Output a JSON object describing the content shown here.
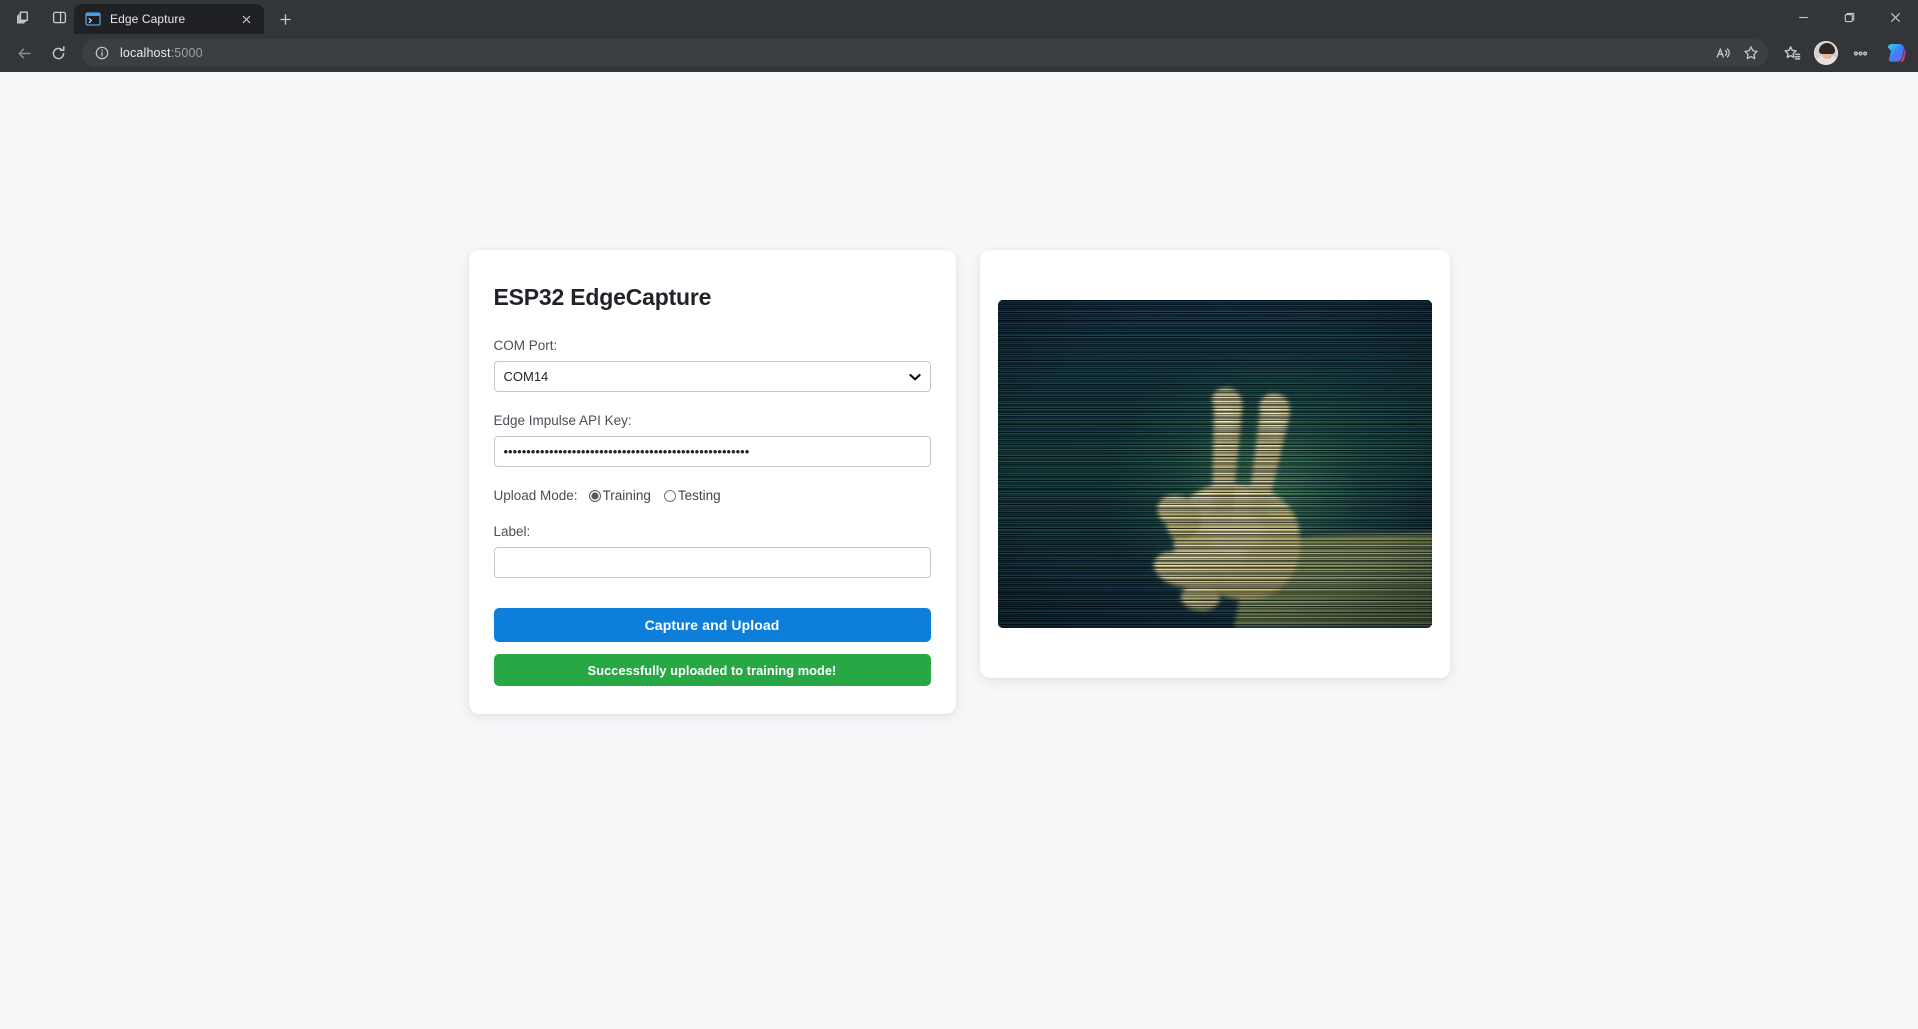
{
  "browser": {
    "window_icons": {
      "workspaces": "workspaces-icon",
      "split_screen": "split-screen-icon",
      "minimize": "minimize-icon",
      "maximize": "restore-icon",
      "close": "window-close-icon"
    },
    "tab": {
      "title": "Edge Capture",
      "favicon": "terminal-window-icon",
      "close_icon": "tab-close-icon"
    },
    "new_tab_label": "+",
    "nav": {
      "back_icon": "back-arrow-icon",
      "refresh_icon": "refresh-icon"
    },
    "omnibox": {
      "info_icon": "site-info-icon",
      "url_host": "localhost",
      "url_port": ":5000",
      "read_aloud_icon": "read-aloud-icon",
      "favorite_icon": "star-icon"
    },
    "toolbar_right": {
      "collections_icon": "collections-icon",
      "profile_icon": "profile-avatar",
      "settings_icon": "more-options-icon",
      "copilot_icon": "copilot-icon"
    }
  },
  "app": {
    "title": "ESP32 EdgeCapture",
    "com_port": {
      "label": "COM Port:",
      "value": "COM14",
      "options": [
        "COM14"
      ],
      "caret_icon": "chevron-down-icon"
    },
    "api_key": {
      "label": "Edge Impulse API Key:",
      "value": "••••••••••••••••••••••••••••••••••••••••••••••••••••••",
      "placeholder": ""
    },
    "upload_mode": {
      "label": "Upload Mode:",
      "options": [
        {
          "label": "Training",
          "selected": true
        },
        {
          "label": "Testing",
          "selected": false
        }
      ]
    },
    "label_field": {
      "label": "Label:",
      "value": "",
      "placeholder": ""
    },
    "capture_button": "Capture and Upload",
    "status_message": "Successfully uploaded to training mode!"
  },
  "preview": {
    "alt": "Captured ESP32 camera frame: hand showing peace sign with scanline glitch artifacts"
  },
  "colors": {
    "primary_button": "#0d7fdb",
    "success_bar": "#28a745",
    "page_background": "#f6f7f9",
    "card_background": "#ffffff",
    "title_text": "#1f2328"
  }
}
